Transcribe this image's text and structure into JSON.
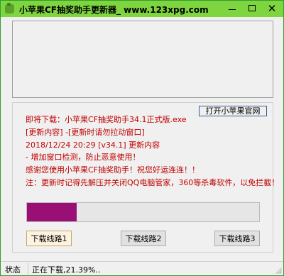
{
  "window": {
    "title": "小苹果CF抽奖助手更新器_ www.123xpg.com",
    "minimize_icon": "minimize-icon",
    "maximize_icon": "maximize-icon",
    "close_label": "✕"
  },
  "info": {
    "official_link": "打开小苹果官网",
    "lines": [
      "即将下载：小苹果CF抽奖助手34.1正式版.exe",
      "[更新内容] -[更新时请勿拉动窗口]",
      "2018/12/24 20:29 [v34.1] 更新内容",
      "- 增加窗口检测，防止恶意使用！",
      "感谢您使用小苹果CF抽奖助手！祝您好运连连！！",
      "注：更新时记得先解压并关闭QQ电脑管家，360等杀毒软件，以免拦截！"
    ],
    "text_color": "#c00000"
  },
  "progress": {
    "value_percent": 21.39,
    "fill_color": "#9a0f76"
  },
  "buttons": {
    "line1": "下载线路1",
    "line2": "下载线路2",
    "line3": "下载线路3"
  },
  "status": {
    "label": "状态",
    "text": "正在下载,21.39%.."
  }
}
